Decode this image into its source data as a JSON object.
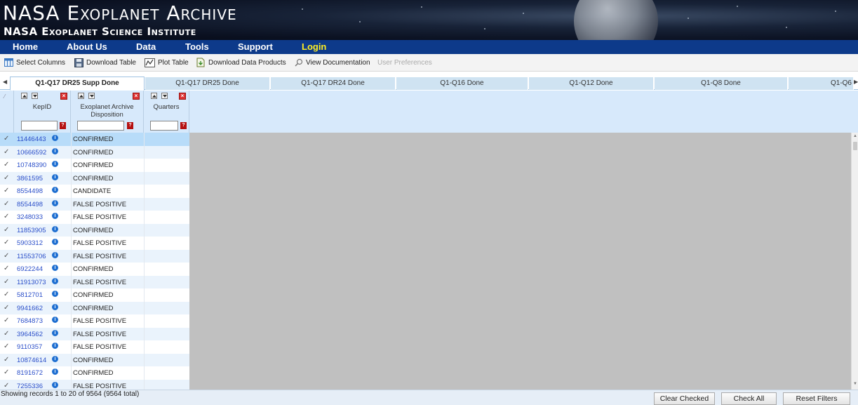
{
  "header": {
    "title": "NASA Exoplanet Archive",
    "subtitle": "NASA Exoplanet Science Institute"
  },
  "nav": {
    "items": [
      "Home",
      "About Us",
      "Data",
      "Tools",
      "Support",
      "Login"
    ]
  },
  "toolbar": {
    "select_columns": "Select Columns",
    "download_table": "Download Table",
    "plot_table": "Plot Table",
    "download_data_products": "Download Data Products",
    "view_documentation": "View Documentation",
    "user_preferences": "User Preferences"
  },
  "tabs": [
    "Q1-Q17 DR25 Supp Done",
    "Q1-Q17 DR25 Done",
    "Q1-Q17 DR24 Done",
    "Q1-Q16 Done",
    "Q1-Q12 Done",
    "Q1-Q8 Done",
    "Q1-Q6"
  ],
  "columns": {
    "kepid": "KepID",
    "disposition_line1": "Exoplanet Archive",
    "disposition_line2": "Disposition",
    "quarters": "Quarters"
  },
  "rows": [
    {
      "kepid": "11446443",
      "disposition": "CONFIRMED"
    },
    {
      "kepid": "10666592",
      "disposition": "CONFIRMED"
    },
    {
      "kepid": "10748390",
      "disposition": "CONFIRMED"
    },
    {
      "kepid": "3861595",
      "disposition": "CONFIRMED"
    },
    {
      "kepid": "8554498",
      "disposition": "CANDIDATE"
    },
    {
      "kepid": "8554498",
      "disposition": "FALSE POSITIVE"
    },
    {
      "kepid": "3248033",
      "disposition": "FALSE POSITIVE"
    },
    {
      "kepid": "11853905",
      "disposition": "CONFIRMED"
    },
    {
      "kepid": "5903312",
      "disposition": "FALSE POSITIVE"
    },
    {
      "kepid": "11553706",
      "disposition": "FALSE POSITIVE"
    },
    {
      "kepid": "6922244",
      "disposition": "CONFIRMED"
    },
    {
      "kepid": "11913073",
      "disposition": "FALSE POSITIVE"
    },
    {
      "kepid": "5812701",
      "disposition": "CONFIRMED"
    },
    {
      "kepid": "9941662",
      "disposition": "CONFIRMED"
    },
    {
      "kepid": "7684873",
      "disposition": "FALSE POSITIVE"
    },
    {
      "kepid": "3964562",
      "disposition": "FALSE POSITIVE"
    },
    {
      "kepid": "9110357",
      "disposition": "FALSE POSITIVE"
    },
    {
      "kepid": "10874614",
      "disposition": "CONFIRMED"
    },
    {
      "kepid": "8191672",
      "disposition": "CONFIRMED"
    },
    {
      "kepid": "7255336",
      "disposition": "FALSE POSITIVE"
    }
  ],
  "footer": {
    "status": "Showing records 1 to 20 of 9564 (9564 total)",
    "clear_checked": "Clear Checked",
    "check_all": "Check All",
    "reset_filters": "Reset Filters"
  },
  "icons": {
    "info": "info-icon",
    "checkbox": "check-icon",
    "filter_help": "help-icon"
  },
  "colors": {
    "nav_bg": "#0d3a8a",
    "login": "#ffee22",
    "link": "#2a4ec9",
    "header_band": "#d7e9fb",
    "selected_row": "#b8dcf9"
  }
}
